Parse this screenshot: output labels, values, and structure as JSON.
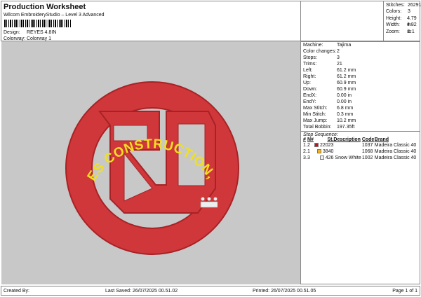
{
  "header": {
    "title": "Production Worksheet",
    "subtitle": "Wilcom EmbroideryStudio – Level 3 Advanced",
    "design_label": "Design:",
    "design_value": "REYES 4.8IN",
    "colorway_label": "Colorway:",
    "colorway_value": "Colorway 1"
  },
  "stats": [
    {
      "label": "Stitches:",
      "value": "26291"
    },
    {
      "label": "Colors:",
      "value": "3"
    },
    {
      "label": "Height:",
      "value": "4.79 in"
    },
    {
      "label": "Width:",
      "value": "4.82 in"
    },
    {
      "label": "Zoom:",
      "value": "1:1"
    }
  ],
  "properties": [
    {
      "label": "Machine:",
      "value": "Tajima"
    },
    {
      "label": "Color changes:",
      "value": "2"
    },
    {
      "label": "Stops:",
      "value": "3"
    },
    {
      "label": "Trims:",
      "value": "21"
    },
    {
      "label": "Left:",
      "value": "61.2 mm"
    },
    {
      "label": "Right:",
      "value": "61.2 mm"
    },
    {
      "label": "Up:",
      "value": "60.9 mm"
    },
    {
      "label": "Down:",
      "value": "60.9 mm"
    },
    {
      "label": "EndX:",
      "value": "0.00 in"
    },
    {
      "label": "EndY:",
      "value": "0.00 in"
    },
    {
      "label": "Max Stitch:",
      "value": "6.8 mm"
    },
    {
      "label": "Min Stitch:",
      "value": "0.3 mm"
    },
    {
      "label": "Max Jump:",
      "value": "10.2 mm"
    },
    {
      "label": "Total Bobbin:",
      "value": "197.35ft"
    }
  ],
  "stop_sequence": {
    "title": "Stop Sequence:",
    "headers": [
      "#",
      "N#",
      "St.",
      "Description",
      "Code",
      "Brand"
    ],
    "rows": [
      {
        "idx": "1.",
        "n": "2",
        "color": "#c0141e",
        "st": "22023",
        "desc": "",
        "code": "1037",
        "brand": "Madeira Classic 40"
      },
      {
        "idx": "2.",
        "n": "1",
        "color": "#f2b418",
        "st": "3840",
        "desc": "",
        "code": "1068",
        "brand": "Madeira Classic 40"
      },
      {
        "idx": "3.",
        "n": "3",
        "color": "#f2f2f2",
        "st": "426",
        "desc": "Snow White",
        "code": "1002",
        "brand": "Madeira Classic 40"
      }
    ]
  },
  "design": {
    "text": "REYES CONSTRUCTION, LLC",
    "red": "#d0373a",
    "yellow": "#f0e020"
  },
  "footer": {
    "created": "Created By:",
    "saved": "Last Saved: 26/07/2025 00.51.02",
    "printed": "Printed: 26/07/2025 00.51.05",
    "page": "Page 1 of 1"
  }
}
